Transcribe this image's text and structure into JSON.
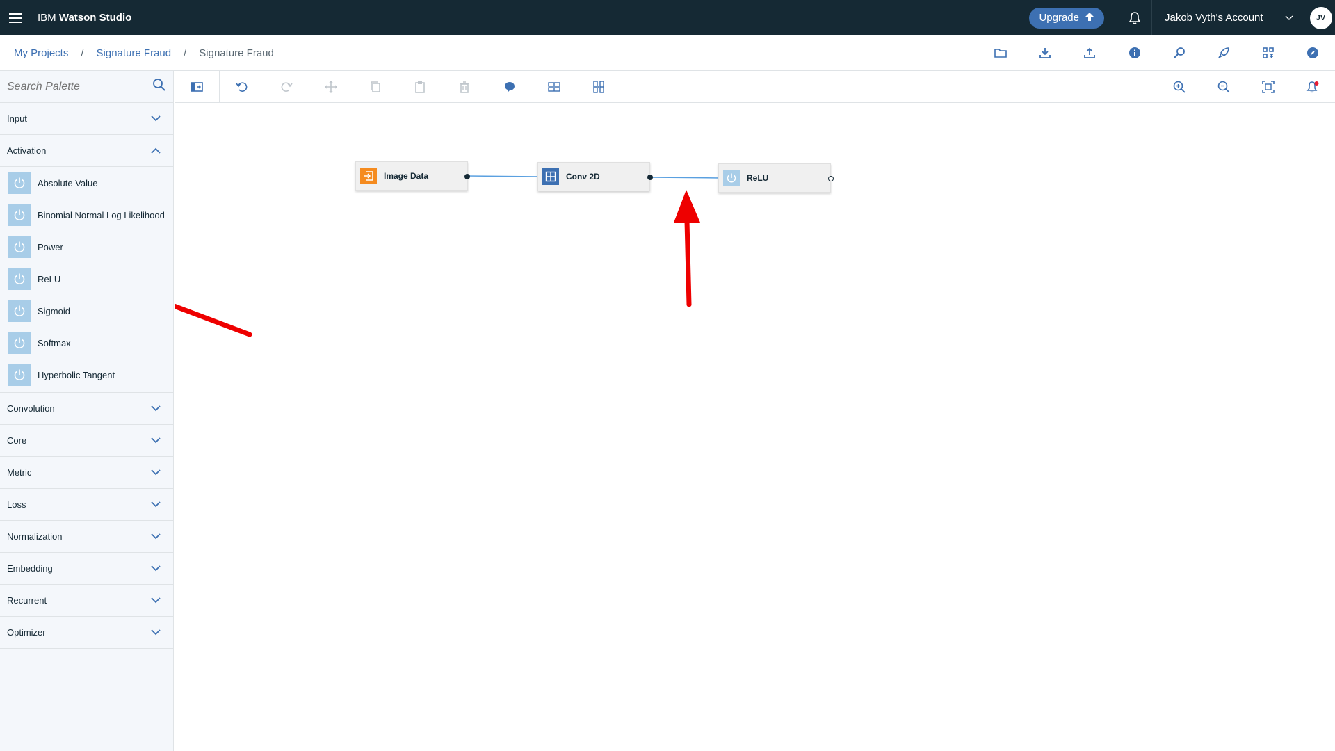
{
  "app": {
    "brand_prefix": "IBM",
    "brand_name": "Watson Studio"
  },
  "header": {
    "upgrade_label": "Upgrade",
    "account_label": "Jakob Vyth's Account",
    "avatar_initials": "JV"
  },
  "breadcrumb": {
    "items": [
      "My Projects",
      "Signature Fraud"
    ],
    "current": "Signature Fraud",
    "separator": "/"
  },
  "palette": {
    "search_placeholder": "Search Palette",
    "categories": {
      "input": "Input",
      "activation": "Activation",
      "convolution": "Convolution",
      "core": "Core",
      "metric": "Metric",
      "loss": "Loss",
      "normalization": "Normalization",
      "embedding": "Embedding",
      "recurrent": "Recurrent",
      "optimizer": "Optimizer"
    },
    "activation_items": [
      "Absolute Value",
      "Binomial Normal Log Likelihood",
      "Power",
      "ReLU",
      "Sigmoid",
      "Softmax",
      "Hyperbolic Tangent"
    ]
  },
  "canvas": {
    "nodes": [
      {
        "label": "Image Data",
        "icon": "import-icon",
        "icon_color": "#f58b1f"
      },
      {
        "label": "Conv 2D",
        "icon": "grid-icon",
        "icon_color": "#3d70b2"
      },
      {
        "label": "ReLU",
        "icon": "power-icon",
        "icon_color": "#a8cde8"
      }
    ]
  },
  "colors": {
    "header_bg": "#152934",
    "accent": "#3d70b2",
    "annotation_arrow": "#ee0000",
    "link_line": "#5aa0e0"
  }
}
